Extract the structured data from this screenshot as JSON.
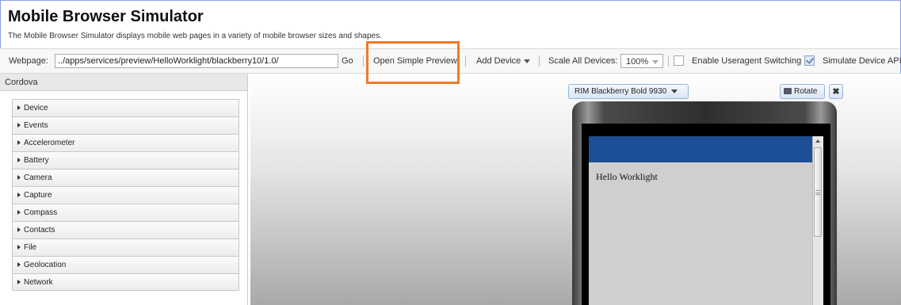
{
  "header": {
    "title": "Mobile Browser Simulator",
    "subtitle": "The Mobile Browser Simulator displays mobile web pages in a variety of mobile browser sizes and shapes."
  },
  "toolbar": {
    "webpage_label": "Webpage:",
    "webpage_value": "../apps/services/preview/HelloWorklight/blackberry10/1.0/",
    "go_label": "Go",
    "open_preview_label": "Open Simple Preview",
    "add_device_label": "Add Device",
    "scale_label": "Scale All Devices:",
    "scale_value": "100%",
    "useragent_label": "Enable Useragent Switching",
    "useragent_checked": false,
    "simulate_api_label": "Simulate Device API",
    "simulate_api_checked": true
  },
  "sidebar": {
    "header": "Cordova",
    "items": [
      {
        "label": "Device"
      },
      {
        "label": "Events"
      },
      {
        "label": "Accelerometer"
      },
      {
        "label": "Battery"
      },
      {
        "label": "Camera"
      },
      {
        "label": "Capture"
      },
      {
        "label": "Compass"
      },
      {
        "label": "Contacts"
      },
      {
        "label": "File"
      },
      {
        "label": "Geolocation"
      },
      {
        "label": "Network"
      }
    ]
  },
  "device": {
    "selected": "RIM Blackberry Bold 9930",
    "rotate_label": "Rotate",
    "close_glyph": "✖",
    "page_text": "Hello Worklight"
  },
  "colors": {
    "highlight": "#f07a2a",
    "app_header": "#1d4f96"
  }
}
